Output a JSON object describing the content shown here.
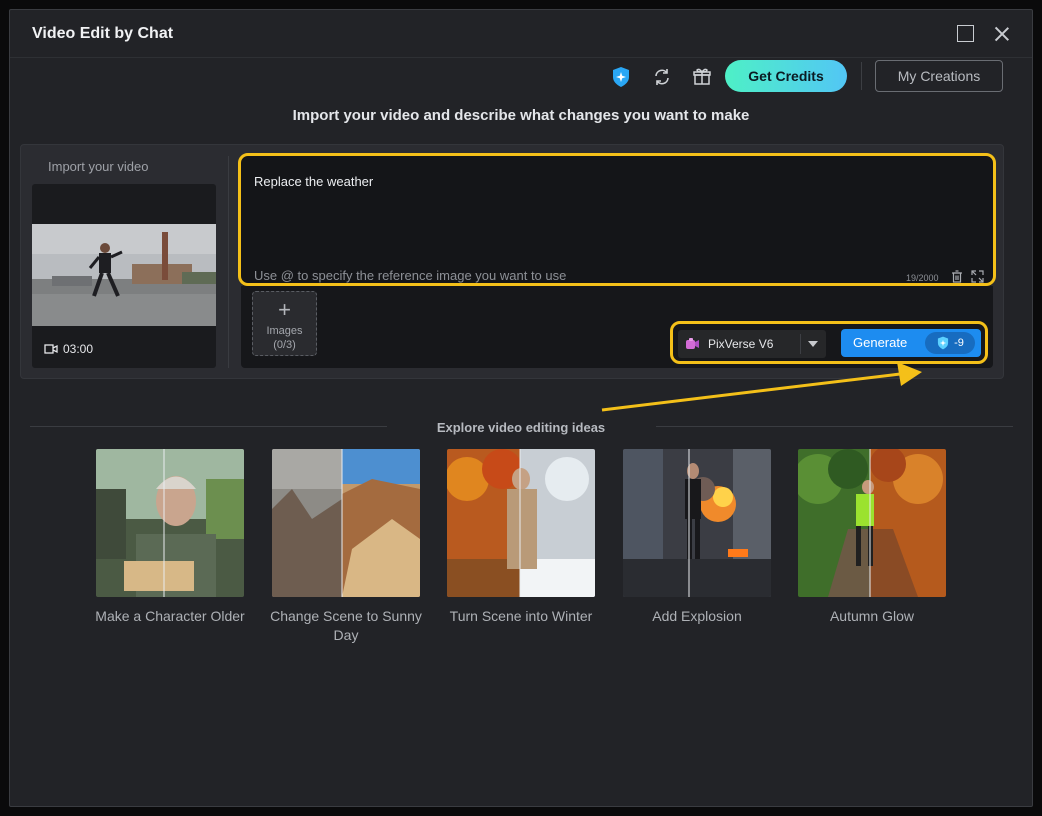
{
  "window": {
    "title": "Video Edit by Chat"
  },
  "toolbar": {
    "icons": [
      "credit-badge-icon",
      "refresh-icon",
      "gift-icon"
    ],
    "get_credits_label": "Get Credits",
    "my_creations_label": "My Creations"
  },
  "headline": "Import your video and describe what changes you want to make",
  "import": {
    "label": "Import your video",
    "duration": "03:00"
  },
  "prompt": {
    "value": "Replace the weather",
    "hint": "Use @ to specify the reference image you want to use",
    "counter": "19/2000"
  },
  "images": {
    "label": "Images",
    "count": "(0/3)"
  },
  "model": {
    "name": "PixVerse V6"
  },
  "generate": {
    "label": "Generate",
    "cost": "-9"
  },
  "explore": {
    "title": "Explore video editing ideas",
    "ideas": [
      {
        "label": "Make a Character Older"
      },
      {
        "label": "Change Scene to Sunny Day"
      },
      {
        "label": "Turn Scene into Winter"
      },
      {
        "label": "Add Explosion"
      },
      {
        "label": "Autumn Glow"
      }
    ]
  },
  "colors": {
    "window_bg": "#222327",
    "accent_blue": "#1d8cf0",
    "highlight_yellow": "#f4c019",
    "credits_gradient_start": "#4ef0c6",
    "credits_gradient_end": "#52c6f5"
  }
}
